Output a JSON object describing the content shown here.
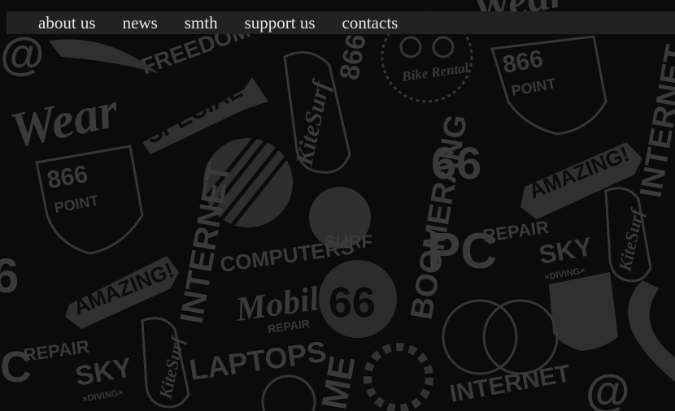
{
  "nav": {
    "items": [
      {
        "label": "about us"
      },
      {
        "label": "news"
      },
      {
        "label": "smth"
      },
      {
        "label": "support us"
      },
      {
        "label": "contacts"
      }
    ]
  },
  "background": {
    "words": {
      "wear": "Wear",
      "special": "SPECIAL",
      "internet": "INTERNET",
      "kitesurf": "KiteSurf",
      "boomerang": "BOOMERANG",
      "computers": "COMPUTERS",
      "mobile": "Mobile",
      "repair": "REPAIR",
      "laptops": "LAPTOPS",
      "amazing": "AMAZING!",
      "point": "POINT",
      "sky": "SKY",
      "diving": "×DIVING×",
      "bike_rental": "Bike Rental",
      "pc": "PC",
      "surf": "SURF",
      "freedom": "FREEDOM",
      "num866": "866",
      "num66": "66",
      "at": "@"
    }
  }
}
